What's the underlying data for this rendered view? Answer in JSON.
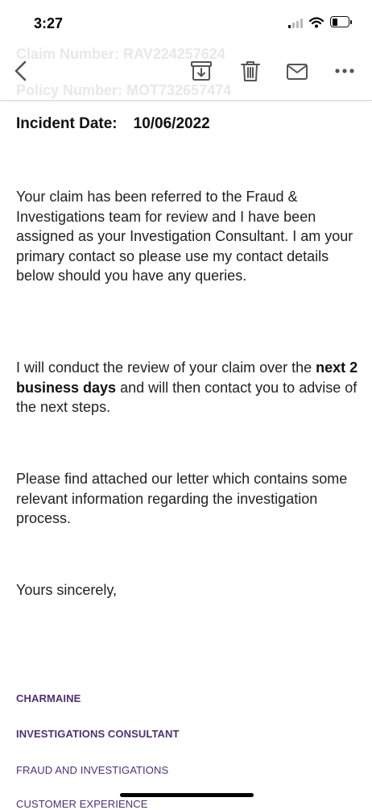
{
  "status_bar": {
    "time": "3:27"
  },
  "header": {
    "claim_number": "Claim Number:  RAV224257624",
    "policy_number": "Policy Number: MOT732657474"
  },
  "toolbar": {
    "icons": [
      "chevron-left-icon",
      "archive-icon",
      "trash-icon",
      "mail-icon",
      "more-icon"
    ]
  },
  "email": {
    "incident_label": "Incident Date:",
    "incident_value": "10/06/2022",
    "para1": "Your claim has been referred to the Fraud & Investigations team for review and I have been assigned as your Investigation Consultant.  I am your primary contact so please use my contact details below should you have any queries.",
    "para2_prefix": "I will conduct the review of your claim over the ",
    "para2_bold": "next 2 business days",
    "para2_suffix": " and will then contact you to advise of the next steps.",
    "para3": "Please find attached our letter which contains some relevant information regarding the investigation process.",
    "closing": "Yours sincerely,"
  },
  "signature": {
    "name": "CHARMAINE",
    "title": "INVESTIGATIONS CONSULTANT",
    "team": "FRAUD AND INVESTIGATIONS",
    "dept": "CUSTOMER EXPERIENCE"
  },
  "colors": {
    "signature": "#50306f",
    "nav_icons": "#555555"
  }
}
